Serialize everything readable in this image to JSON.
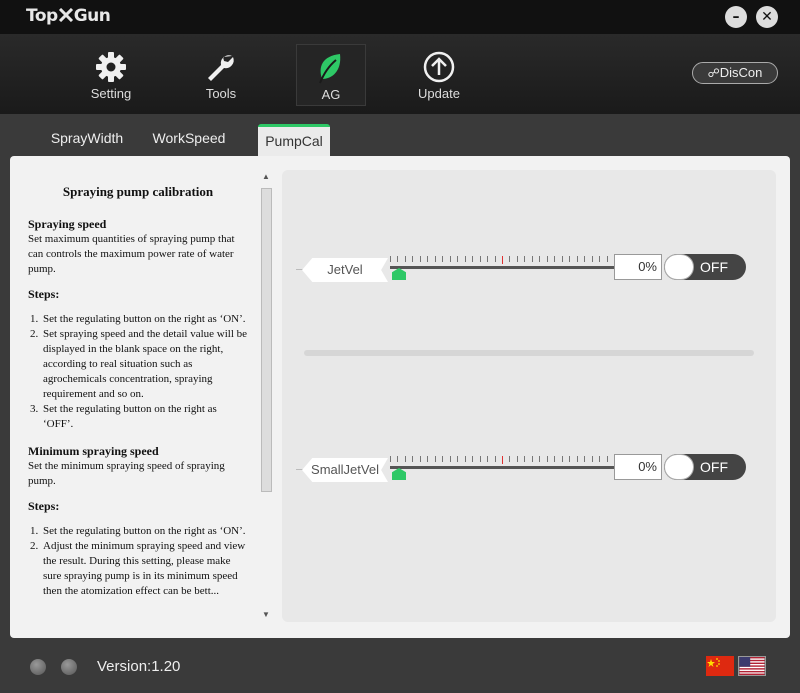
{
  "app": {
    "logo": "TopXGun",
    "minimize_icon": "minimize-icon",
    "close_icon": "close-icon"
  },
  "toolbar": {
    "items": [
      {
        "label": "Setting",
        "icon": "gear-icon"
      },
      {
        "label": "Tools",
        "icon": "wrench-icon"
      },
      {
        "label": "AG",
        "icon": "leaf-icon",
        "active": true
      },
      {
        "label": "Update",
        "icon": "upload-icon"
      }
    ],
    "discon_label": "DisCon",
    "discon_icon": "unlink-icon"
  },
  "tabs": [
    {
      "label": "SprayWidth"
    },
    {
      "label": "WorkSpeed"
    },
    {
      "label": "PumpCal",
      "active": true
    }
  ],
  "doc": {
    "title": "Spraying pump calibration",
    "section1_heading": "Spraying speed",
    "section1_body": "Set maximum quantities of spraying pump that can controls the maximum power rate of water pump.",
    "steps_label_1": "Steps:",
    "steps1": [
      "Set the regulating button on the right as ‘ON’.",
      "Set spraying speed and the detail value will be displayed in the blank space on the right, according to real situation such as agrochemicals concentration, spraying requirement and so on.",
      "Set the regulating button on the right as ‘OFF’."
    ],
    "section2_heading": "Minimum spraying speed",
    "section2_body": "Set the minimum spraying speed of spraying pump.",
    "steps_label_2": "Steps:",
    "steps2": [
      "Set the regulating button on the right as ‘ON’.",
      "Adjust the minimum spraying speed and view the result. During this setting, please make sure spraying pump is in its minimum speed then the atomization effect can be bett..."
    ]
  },
  "controls": {
    "jet": {
      "label": "JetVel",
      "value": "0%",
      "level": 0,
      "toggle": "OFF"
    },
    "small_jet": {
      "label": "SmallJetVel",
      "value": "0%",
      "level": 0,
      "toggle": "OFF"
    }
  },
  "status": {
    "version": "Version:1.20",
    "flags": [
      {
        "name": "china-flag-icon"
      },
      {
        "name": "us-flag-icon",
        "active": true
      }
    ],
    "colors": {
      "accent": "#2ec866",
      "tick_marker": "#e03030"
    }
  }
}
